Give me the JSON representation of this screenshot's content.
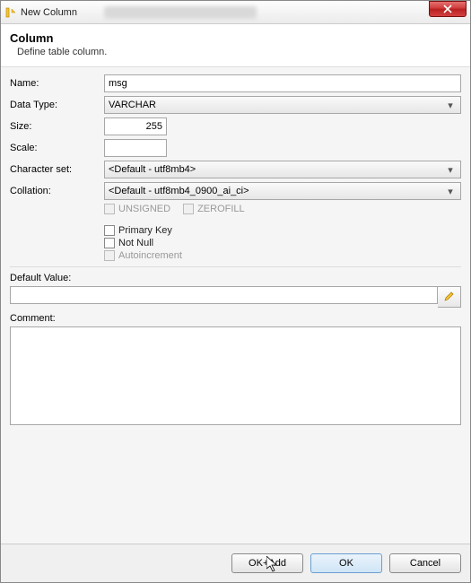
{
  "window": {
    "title": "New Column"
  },
  "header": {
    "title": "Column",
    "subtitle": "Define table column."
  },
  "form": {
    "name_label": "Name:",
    "name_value": "msg",
    "datatype_label": "Data Type:",
    "datatype_value": "VARCHAR",
    "size_label": "Size:",
    "size_value": "255",
    "scale_label": "Scale:",
    "scale_value": "",
    "charset_label": "Character set:",
    "charset_value": "<Default - utf8mb4>",
    "collation_label": "Collation:",
    "collation_value": "<Default - utf8mb4_0900_ai_ci>",
    "unsigned_label": "UNSIGNED",
    "zerofill_label": "ZEROFILL",
    "pk_label": "Primary Key",
    "notnull_label": "Not Null",
    "autoinc_label": "Autoincrement",
    "default_label": "Default Value:",
    "default_value": "",
    "comment_label": "Comment:",
    "comment_value": ""
  },
  "buttons": {
    "ok_add": "OK+Add",
    "ok": "OK",
    "cancel": "Cancel"
  }
}
